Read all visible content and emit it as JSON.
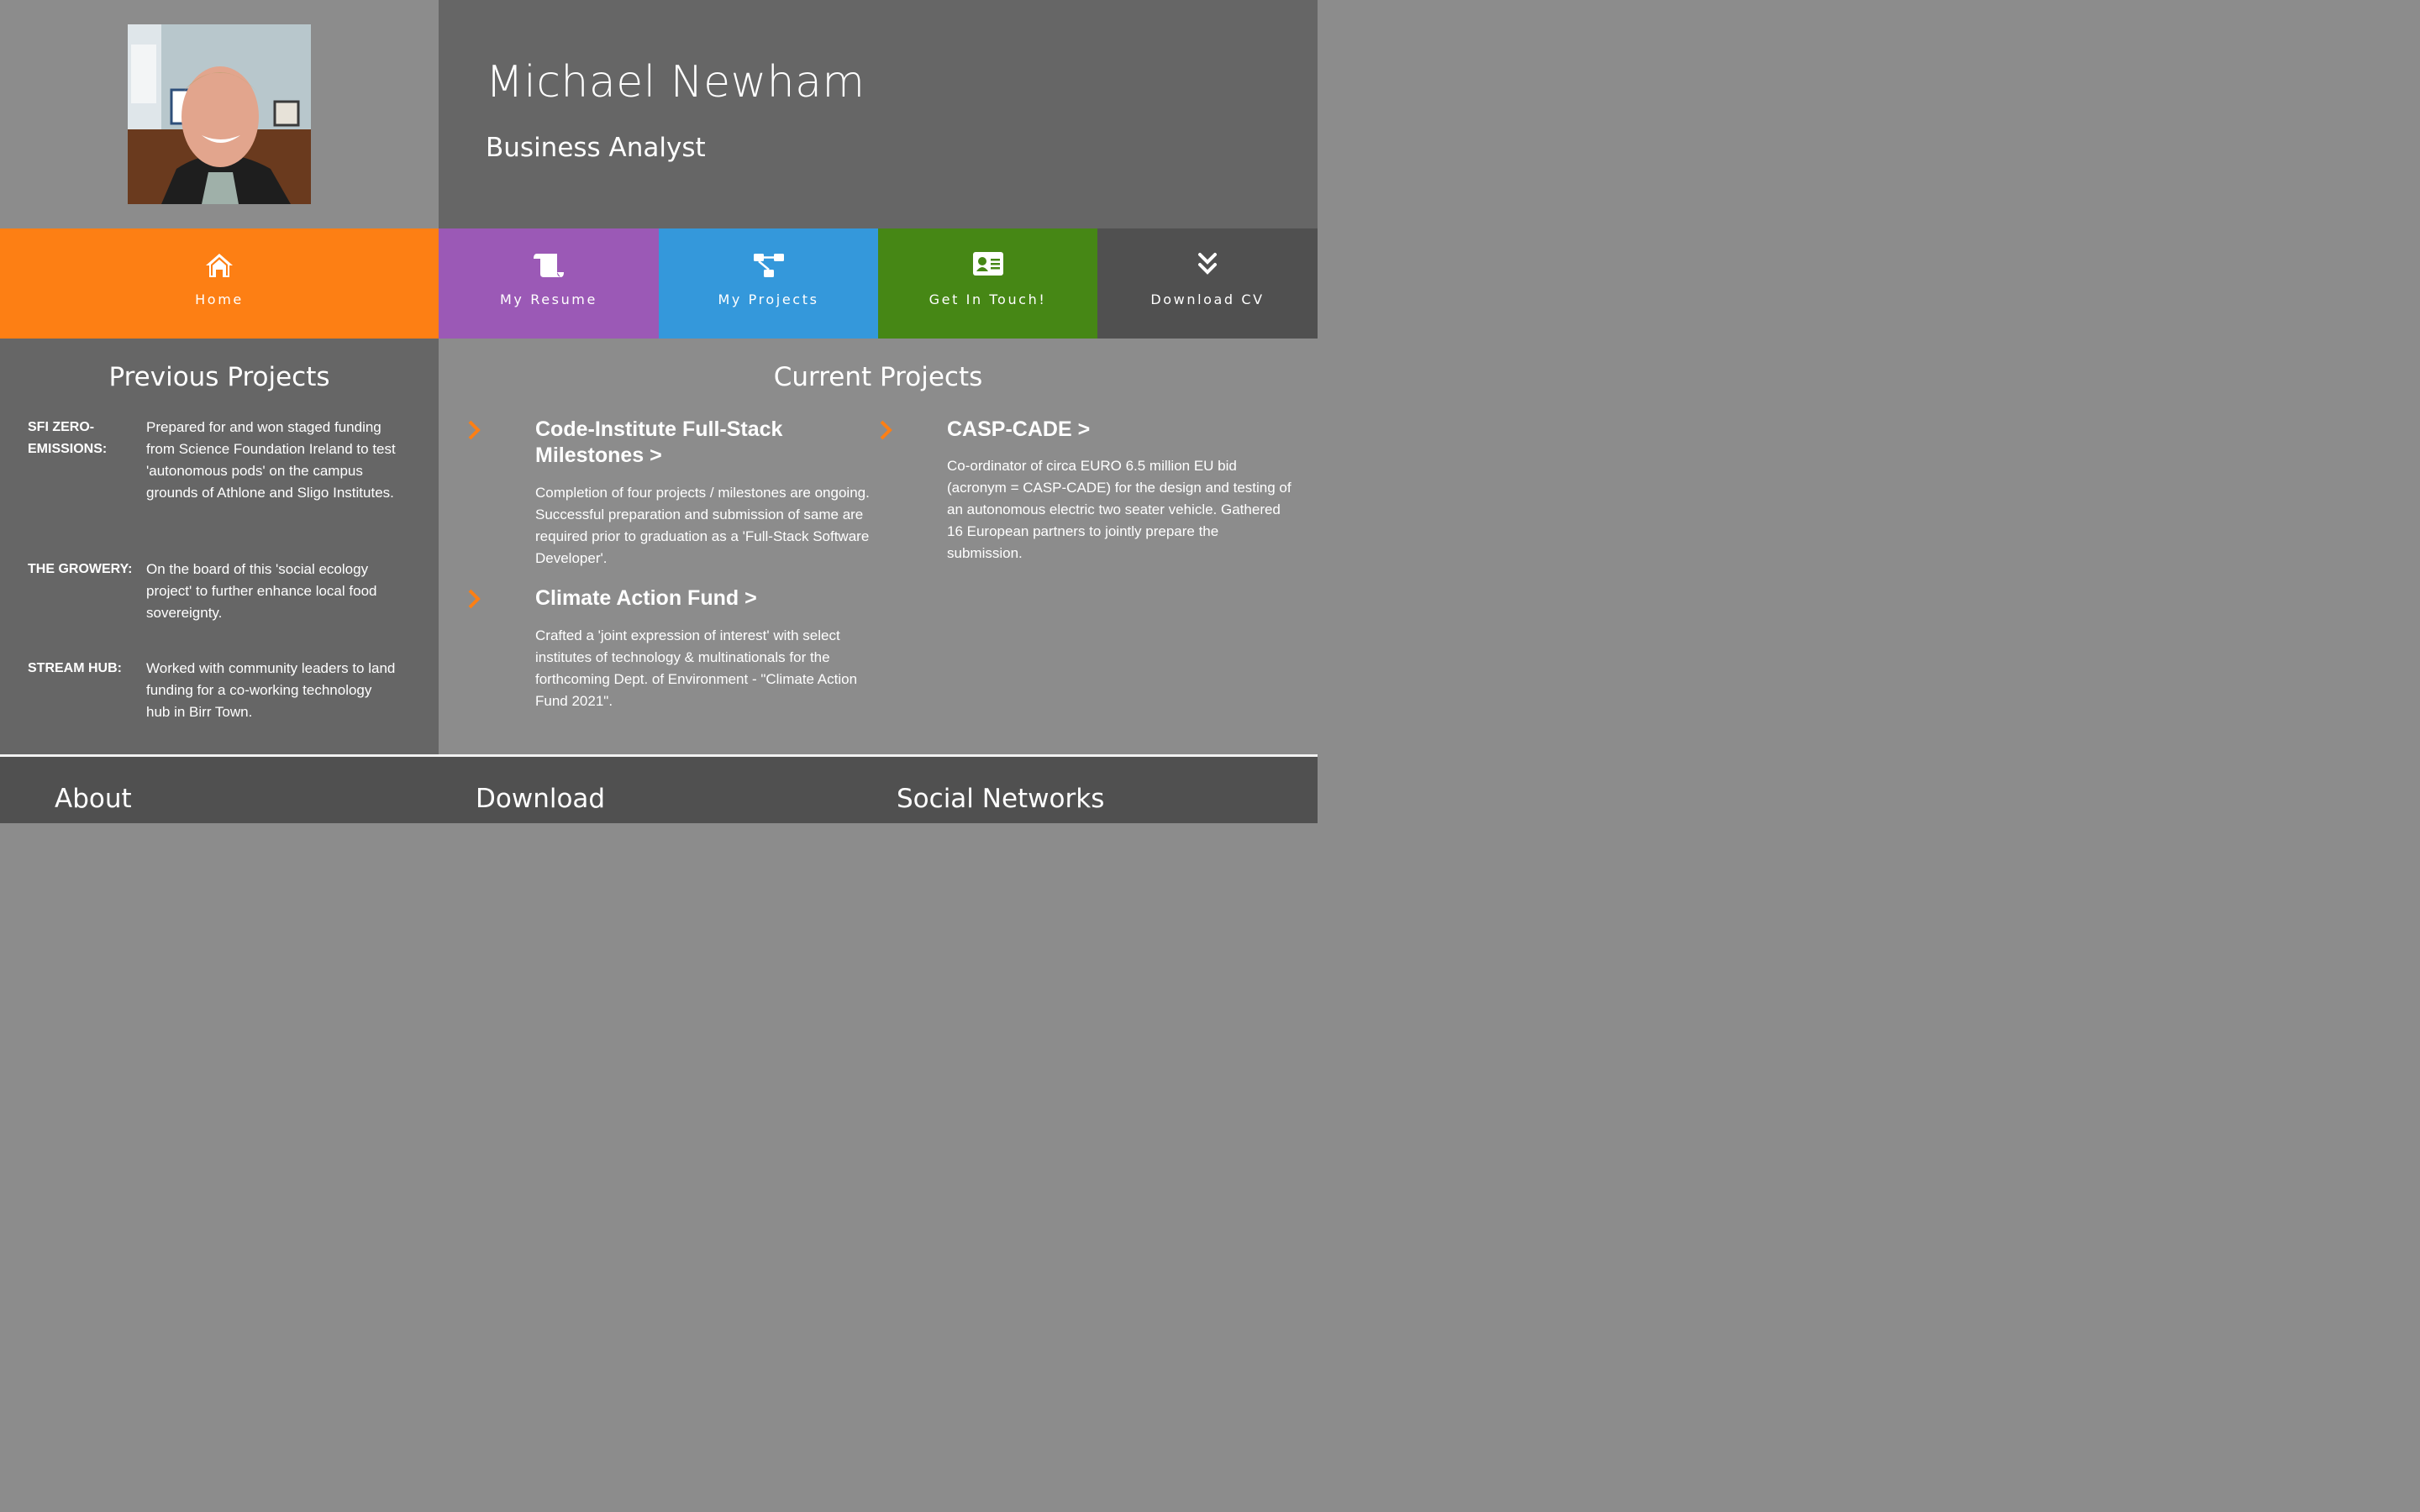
{
  "header": {
    "name": "Michael Newham",
    "role": "Business Analyst",
    "photo_alt": "profile-photo"
  },
  "nav": {
    "items": [
      {
        "label": "Home",
        "icon": "home-icon",
        "color": "#fd7f14"
      },
      {
        "label": "My Resume",
        "icon": "scroll-icon",
        "color": "#9b59b6"
      },
      {
        "label": "My Projects",
        "icon": "sitemap-icon",
        "color": "#3498db"
      },
      {
        "label": "Get In Touch!",
        "icon": "id-card-icon",
        "color": "#468715"
      },
      {
        "label": "Download CV",
        "icon": "double-chevron-down-icon",
        "color": "#505050"
      }
    ]
  },
  "previous": {
    "title": "Previous Projects",
    "items": [
      {
        "label": "SFI ZERO-EMISSIONS:",
        "text": "Prepared for and won staged funding from Science Foundation Ireland to test 'autonomous pods' on the campus grounds of Athlone and Sligo Institutes."
      },
      {
        "label": "THE GROWERY:",
        "text": "On the board of this 'social ecology project' to further enhance local food sovereignty."
      },
      {
        "label": "STREAM HUB:",
        "text": "Worked with community leaders to land funding for a co-working technology hub in Birr Town."
      }
    ]
  },
  "current": {
    "title": "Current Projects",
    "items": [
      {
        "title": "Code-Institute Full-Stack Milestones >",
        "text": "Completion of four projects / milestones are ongoing. Successful preparation and submission of same are required prior to graduation as a 'Full-Stack Software Developer'."
      },
      {
        "title": "Climate Action Fund >",
        "text": "Crafted a 'joint expression of interest' with select institutes of technology & multinationals for the forthcoming Dept. of Environment - \"Climate Action Fund 2021\"."
      },
      {
        "title": "CASP-CADE >",
        "text": "Co-ordinator of circa EURO 6.5 million EU bid (acronym = CASP-CADE) for the design and testing of an autonomous electric two seater vehicle. Gathered 16 European partners to jointly prepare the submission."
      }
    ],
    "chevron_color": "#fd7f14"
  },
  "footer": {
    "about": "About",
    "download": "Download",
    "social": "Social Networks"
  }
}
